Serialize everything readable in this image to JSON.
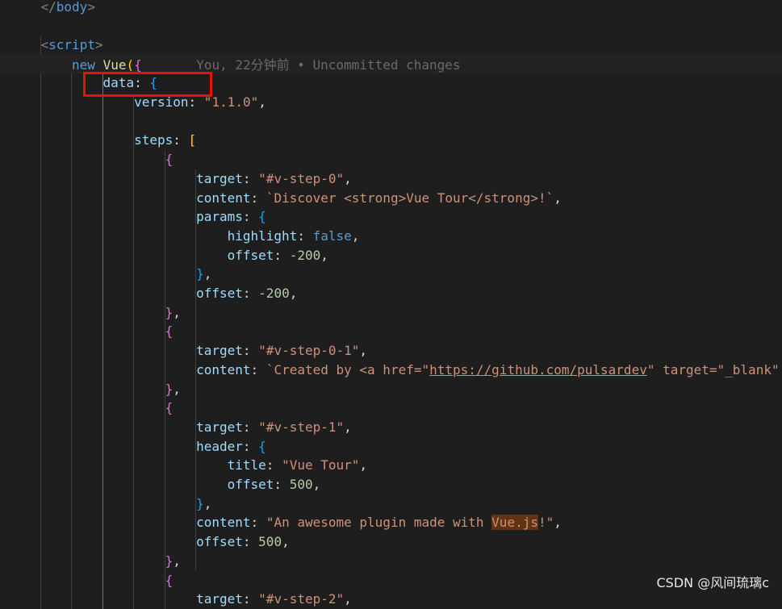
{
  "editor": {
    "blame_annotation": "You, 22分钟前 • Uncommitted changes",
    "lines": [
      [
        [
          "</",
          "t-tag"
        ],
        [
          "body",
          "t-tagname"
        ],
        [
          ">",
          "t-tag"
        ]
      ],
      [],
      [
        [
          "<",
          "t-tag"
        ],
        [
          "script",
          "t-tagname"
        ],
        [
          ">",
          "t-tag"
        ]
      ],
      [
        [
          "new ",
          "t-kw"
        ],
        [
          "Vue",
          "t-fn"
        ],
        [
          "(",
          "t-br1"
        ],
        [
          "{",
          "t-br2"
        ]
      ],
      [
        [
          "data",
          "t-prop"
        ],
        [
          ": ",
          "t-punc"
        ],
        [
          "{",
          "t-br3"
        ]
      ],
      [
        [
          "version",
          "t-prop"
        ],
        [
          ": ",
          "t-punc"
        ],
        [
          "\"1.1.0\"",
          "t-str"
        ],
        [
          ",",
          "t-punc"
        ]
      ],
      [],
      [
        [
          "steps",
          "t-prop"
        ],
        [
          ": ",
          "t-punc"
        ],
        [
          "[",
          "t-br1"
        ]
      ],
      [
        [
          "{",
          "t-br2"
        ]
      ],
      [
        [
          "target",
          "t-prop"
        ],
        [
          ": ",
          "t-punc"
        ],
        [
          "\"#v-step-0\"",
          "t-str"
        ],
        [
          ",",
          "t-punc"
        ]
      ],
      [
        [
          "content",
          "t-prop"
        ],
        [
          ": ",
          "t-punc"
        ],
        [
          "`Discover <strong>Vue Tour</strong>!`",
          "t-str"
        ],
        [
          ",",
          "t-punc"
        ]
      ],
      [
        [
          "params",
          "t-prop"
        ],
        [
          ": ",
          "t-punc"
        ],
        [
          "{",
          "t-br3"
        ]
      ],
      [
        [
          "highlight",
          "t-prop"
        ],
        [
          ": ",
          "t-punc"
        ],
        [
          "false",
          "t-kw"
        ],
        [
          ",",
          "t-punc"
        ]
      ],
      [
        [
          "offset",
          "t-prop"
        ],
        [
          ": ",
          "t-punc"
        ],
        [
          "-200",
          "t-num"
        ],
        [
          ",",
          "t-punc"
        ]
      ],
      [
        [
          "}",
          "t-br3"
        ],
        [
          ",",
          "t-punc"
        ]
      ],
      [
        [
          "offset",
          "t-prop"
        ],
        [
          ": ",
          "t-punc"
        ],
        [
          "-200",
          "t-num"
        ],
        [
          ",",
          "t-punc"
        ]
      ],
      [
        [
          "}",
          "t-br2"
        ],
        [
          ",",
          "t-punc"
        ]
      ],
      [
        [
          "{",
          "t-br2"
        ]
      ],
      [
        [
          "target",
          "t-prop"
        ],
        [
          ": ",
          "t-punc"
        ],
        [
          "\"#v-step-0-1\"",
          "t-str"
        ],
        [
          ",",
          "t-punc"
        ]
      ],
      [
        [
          "content",
          "t-prop"
        ],
        [
          ": ",
          "t-punc"
        ],
        [
          "`Created by <a href=\"",
          "t-str"
        ],
        [
          "https://github.com/pulsardev",
          "t-link"
        ],
        [
          "\" target=\"_blank\"",
          "t-str"
        ]
      ],
      [
        [
          "}",
          "t-br2"
        ],
        [
          ",",
          "t-punc"
        ]
      ],
      [
        [
          "{",
          "t-br2"
        ]
      ],
      [
        [
          "target",
          "t-prop"
        ],
        [
          ": ",
          "t-punc"
        ],
        [
          "\"#v-step-1\"",
          "t-str"
        ],
        [
          ",",
          "t-punc"
        ]
      ],
      [
        [
          "header",
          "t-prop"
        ],
        [
          ": ",
          "t-punc"
        ],
        [
          "{",
          "t-br3"
        ]
      ],
      [
        [
          "title",
          "t-prop"
        ],
        [
          ": ",
          "t-punc"
        ],
        [
          "\"Vue Tour\"",
          "t-str"
        ],
        [
          ",",
          "t-punc"
        ]
      ],
      [
        [
          "offset",
          "t-prop"
        ],
        [
          ": ",
          "t-punc"
        ],
        [
          "500",
          "t-num"
        ],
        [
          ",",
          "t-punc"
        ]
      ],
      [
        [
          "}",
          "t-br3"
        ],
        [
          ",",
          "t-punc"
        ]
      ],
      [
        [
          "content",
          "t-prop"
        ],
        [
          ": ",
          "t-punc"
        ],
        [
          "\"An awesome plugin made with ",
          "t-str"
        ],
        [
          "Vue.js",
          "t-str t-hl"
        ],
        [
          "!\"",
          "t-str"
        ],
        [
          ",",
          "t-punc"
        ]
      ],
      [
        [
          "offset",
          "t-prop"
        ],
        [
          ": ",
          "t-punc"
        ],
        [
          "500",
          "t-num"
        ],
        [
          ",",
          "t-punc"
        ]
      ],
      [
        [
          "}",
          "t-br2"
        ],
        [
          ",",
          "t-punc"
        ]
      ],
      [
        [
          "{",
          "t-br2"
        ]
      ],
      [
        [
          "target",
          "t-prop"
        ],
        [
          ": ",
          "t-punc"
        ],
        [
          "\"#v-step-2\"",
          "t-str"
        ],
        [
          ",",
          "t-punc"
        ]
      ]
    ]
  },
  "watermark": "CSDN @风间琉璃c"
}
